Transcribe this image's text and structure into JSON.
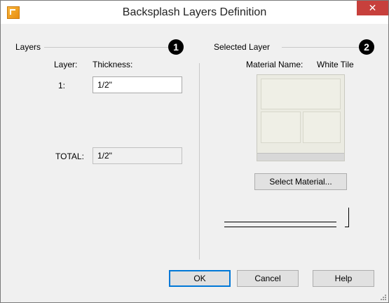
{
  "window": {
    "title": "Backsplash Layers Definition",
    "close_glyph": "✕"
  },
  "layers_group": {
    "label": "Layers",
    "callout": "1",
    "col_layer": "Layer:",
    "col_thickness": "Thickness:",
    "rows": [
      {
        "index": "1:",
        "thickness": "1/2\""
      }
    ],
    "total_label": "TOTAL:",
    "total_value": "1/2\""
  },
  "selected_layer_group": {
    "label": "Selected Layer",
    "callout": "2",
    "material_name_label": "Material Name:",
    "material_name_value": "White Tile",
    "select_material_button": "Select Material..."
  },
  "buttons": {
    "ok": "OK",
    "cancel": "Cancel",
    "help": "Help"
  },
  "icons": {
    "app": "backsplash-app-icon",
    "close": "close-icon",
    "resize": "resize-grip-icon"
  },
  "colors": {
    "close_bg": "#c7403c",
    "default_button_border": "#0078d7"
  }
}
